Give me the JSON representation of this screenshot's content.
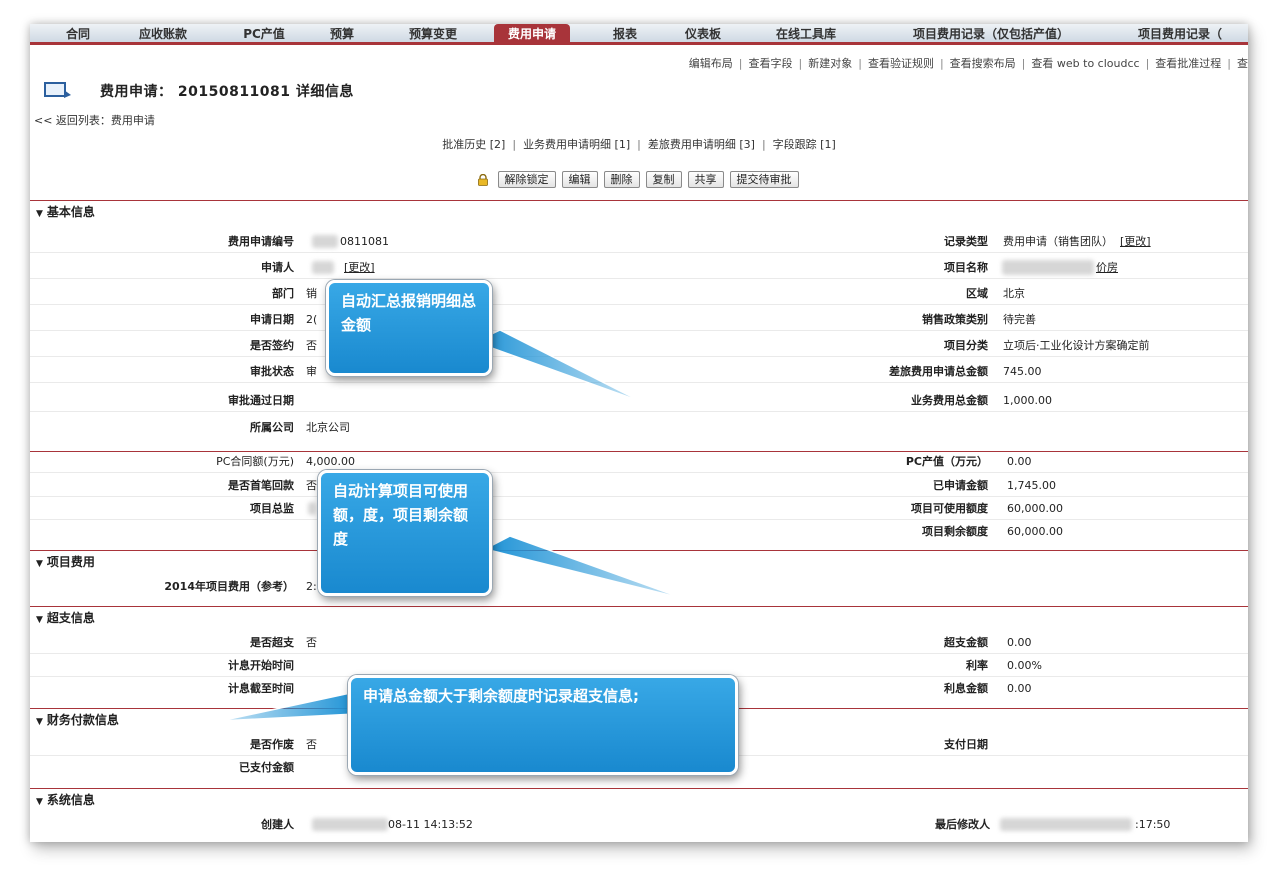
{
  "tabs": [
    {
      "label": "合同",
      "active": false
    },
    {
      "label": "应收账款",
      "active": false
    },
    {
      "label": "PC产值",
      "active": false
    },
    {
      "label": "预算",
      "active": false
    },
    {
      "label": "预算变更",
      "active": false
    },
    {
      "label": "费用申请",
      "active": true
    },
    {
      "label": "报表",
      "active": false
    },
    {
      "label": "仪表板",
      "active": false
    },
    {
      "label": "在线工具库",
      "active": false
    },
    {
      "label": "项目费用记录（仅包括产值）",
      "active": false
    },
    {
      "label": "项目费用记录（",
      "active": false
    }
  ],
  "admin_links": [
    "编辑布局",
    "查看字段",
    "新建对象",
    "查看验证规则",
    "查看搜索布局",
    "查看 web to cloudcc",
    "查看批准过程",
    "查"
  ],
  "page_title": "费用申请： 20150811081 详细信息",
  "back_link": "<< 返回列表：费用申请",
  "related_links": [
    "批准历史 [2]",
    "业务费用申请明细 [1]",
    "差旅费用申请明细 [3]",
    "字段跟踪 [1]"
  ],
  "buttons": {
    "unlock": "解除锁定",
    "edit": "编辑",
    "delete": "删除",
    "copy": "复制",
    "share": "共享",
    "submit": "提交待审批"
  },
  "edit_link": "[更改]",
  "sections": {
    "basic": "基本信息",
    "project_cost": "项目费用",
    "overspend": "超支信息",
    "finance": "财务付款信息",
    "system": "系统信息"
  },
  "basic": {
    "left": [
      {
        "label": "费用申请编号",
        "value": "0811081"
      },
      {
        "label": "申请人",
        "value": ""
      },
      {
        "label": "部门",
        "value": "销"
      },
      {
        "label": "申请日期",
        "value": "2("
      },
      {
        "label": "是否签约",
        "value": "否"
      },
      {
        "label": "审批状态",
        "value": "审"
      },
      {
        "label": "审批通过日期",
        "value": ""
      },
      {
        "label": "所属公司",
        "value": "北京公司"
      }
    ],
    "right": [
      {
        "label": "记录类型",
        "value": "费用申请（销售团队）"
      },
      {
        "label": "项目名称",
        "value": "价房"
      },
      {
        "label": "区域",
        "value": "北京"
      },
      {
        "label": "销售政策类别",
        "value": "待完善"
      },
      {
        "label": "项目分类",
        "value": "立项后·工业化设计方案确定前"
      },
      {
        "label": "差旅费用申请总金额",
        "value": "745.00"
      },
      {
        "label": "业务费用总金额",
        "value": "1,000.00"
      }
    ]
  },
  "pc": {
    "left": [
      {
        "label": "PC合同额(万元)",
        "value": "4,000.00"
      },
      {
        "label": "是否首笔回款",
        "value": "否"
      },
      {
        "label": "项目总监",
        "value": ""
      }
    ],
    "right": [
      {
        "label": "PC产值（万元）",
        "value": "0.00"
      },
      {
        "label": "已申请金额",
        "value": "1,745.00"
      },
      {
        "label": "项目可使用额度",
        "value": "60,000.00"
      },
      {
        "label": "项目剩余额度",
        "value": "60,000.00"
      }
    ]
  },
  "project_cost": {
    "label": "2014年项目费用（参考）",
    "value": "2:"
  },
  "overspend": {
    "left": [
      {
        "label": "是否超支",
        "value": "否"
      },
      {
        "label": "计息开始时间",
        "value": ""
      },
      {
        "label": "计息截至时间",
        "value": ""
      }
    ],
    "right": [
      {
        "label": "超支金额",
        "value": "0.00"
      },
      {
        "label": "利率",
        "value": "0.00%"
      },
      {
        "label": "利息金额",
        "value": "0.00"
      }
    ]
  },
  "finance": {
    "left": [
      {
        "label": "是否作废",
        "value": "否"
      },
      {
        "label": "已支付金额",
        "value": ""
      }
    ],
    "right": [
      {
        "label": "支付日期",
        "value": ""
      }
    ]
  },
  "system": {
    "created_label": "创建人",
    "created_value": "08-11 14:13:52",
    "modified_label": "最后修改人",
    "modified_value": ":17:50"
  },
  "callouts": [
    "自动汇总报销明细总金额",
    "自动计算项目可使用额，度，项目剩余额度",
    "申请总金额大于剩余额度时记录超支信息;"
  ],
  "colors": {
    "accent": "#a8343a",
    "callout": "#1f93d6"
  }
}
